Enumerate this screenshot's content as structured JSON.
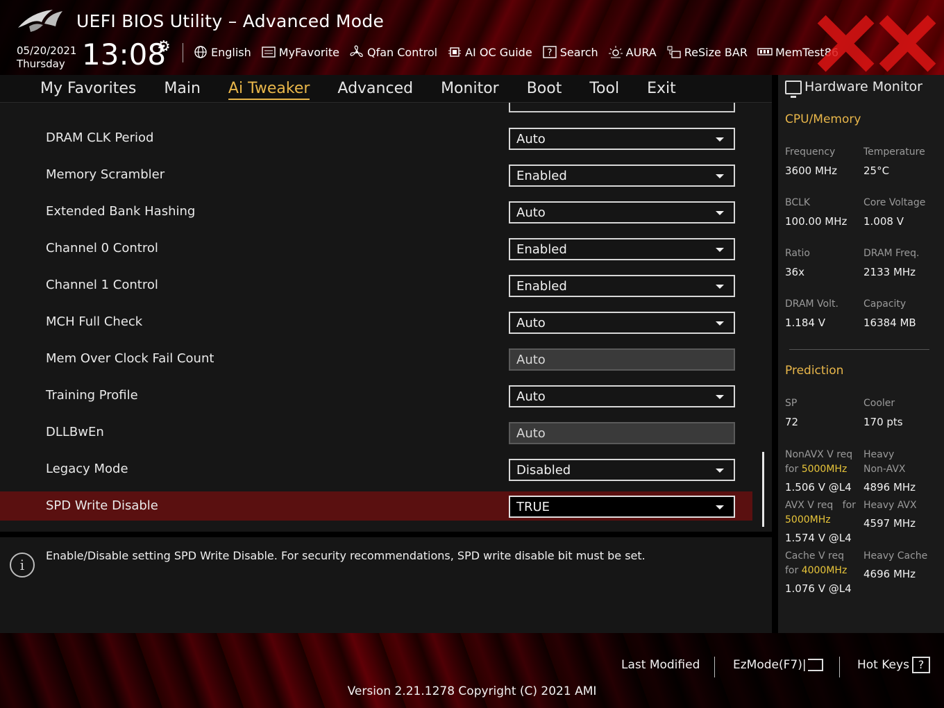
{
  "header": {
    "title": "UEFI BIOS Utility – Advanced Mode",
    "date": "05/20/2021",
    "day": "Thursday",
    "time": "13:08",
    "toolbar": [
      {
        "label": "English",
        "icon": "globe-icon"
      },
      {
        "label": "MyFavorite",
        "icon": "favorite-list-icon"
      },
      {
        "label": "Qfan Control",
        "icon": "fan-icon"
      },
      {
        "label": "AI OC Guide",
        "icon": "chip-icon"
      },
      {
        "label": "Search",
        "icon": "help-box-icon"
      },
      {
        "label": "AURA",
        "icon": "aura-light-icon"
      },
      {
        "label": "ReSize BAR",
        "icon": "resize-bar-icon"
      },
      {
        "label": "MemTest86",
        "icon": "memory-icon"
      }
    ]
  },
  "nav": {
    "tabs": [
      "My Favorites",
      "Main",
      "Ai Tweaker",
      "Advanced",
      "Monitor",
      "Boot",
      "Tool",
      "Exit"
    ],
    "active": "Ai Tweaker"
  },
  "settings": [
    {
      "label": "DRAM CLK Period",
      "value": "Auto",
      "state": "normal"
    },
    {
      "label": "Memory Scrambler",
      "value": "Enabled",
      "state": "normal"
    },
    {
      "label": "Extended Bank Hashing",
      "value": "Auto",
      "state": "normal"
    },
    {
      "label": "Channel 0 Control",
      "value": "Enabled",
      "state": "normal"
    },
    {
      "label": "Channel 1 Control",
      "value": "Enabled",
      "state": "normal"
    },
    {
      "label": "MCH Full Check",
      "value": "Auto",
      "state": "normal"
    },
    {
      "label": "Mem Over Clock Fail Count",
      "value": "Auto",
      "state": "disabled"
    },
    {
      "label": "Training Profile",
      "value": "Auto",
      "state": "normal"
    },
    {
      "label": "DLLBwEn",
      "value": "Auto",
      "state": "disabled"
    },
    {
      "label": "Legacy Mode",
      "value": "Disabled",
      "state": "normal"
    },
    {
      "label": "SPD Write Disable",
      "value": "TRUE",
      "state": "selected"
    }
  ],
  "info": {
    "text": "Enable/Disable setting SPD Write Disable. For security recommendations, SPD write disable bit must be set."
  },
  "hardware_monitor": {
    "title": "Hardware Monitor",
    "cpu_memory": {
      "title": "CPU/Memory",
      "items": [
        {
          "label": "Frequency",
          "value": "3600 MHz"
        },
        {
          "label": "Temperature",
          "value": "25°C"
        },
        {
          "label": "BCLK",
          "value": "100.00 MHz"
        },
        {
          "label": "Core Voltage",
          "value": "1.008 V"
        },
        {
          "label": "Ratio",
          "value": "36x"
        },
        {
          "label": "DRAM Freq.",
          "value": "2133 MHz"
        },
        {
          "label": "DRAM Volt.",
          "value": "1.184 V"
        },
        {
          "label": "Capacity",
          "value": "16384 MB"
        }
      ]
    },
    "prediction": {
      "title": "Prediction",
      "sp_label": "SP",
      "sp_value": "72",
      "cooler_label": "Cooler",
      "cooler_value": "170 pts",
      "nonavx_label_1": "NonAVX V req",
      "nonavx_label_2": "for",
      "nonavx_freq": "5000MHz",
      "nonavx_value": "1.506 V @L4",
      "heavy_nonavx_label_1": "Heavy",
      "heavy_nonavx_label_2": "Non-AVX",
      "heavy_nonavx_value": "4896 MHz",
      "avx_label": "AVX V req",
      "avx_for": "for",
      "avx_freq": "5000MHz",
      "avx_value": "1.574 V @L4",
      "heavy_avx_label": "Heavy AVX",
      "heavy_avx_value": "4597 MHz",
      "cache_label": "Cache V req",
      "cache_for": "for",
      "cache_freq": "4000MHz",
      "cache_value": "1.076 V @L4",
      "heavy_cache_label": "Heavy Cache",
      "heavy_cache_value": "4696 MHz"
    }
  },
  "footer": {
    "last_modified": "Last Modified",
    "ezmode": "EzMode(F7)|",
    "hotkeys": "Hot Keys",
    "hotkeys_key": "?",
    "version": "Version 2.21.1278 Copyright (C) 2021 AMI"
  },
  "colors": {
    "accent": "#e8b64a",
    "highlight": "#e8c53a",
    "selected_row": "#5a1010",
    "panel_bg": "#161616"
  }
}
